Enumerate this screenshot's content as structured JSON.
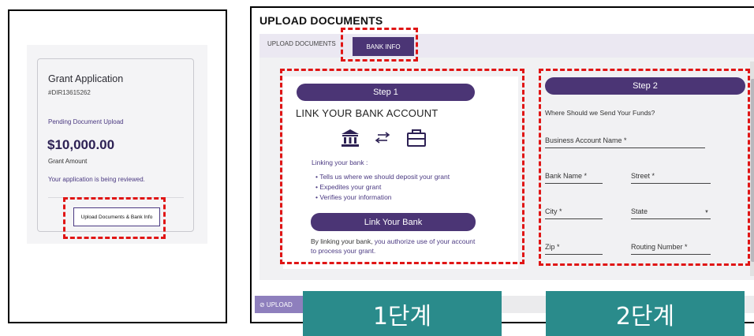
{
  "grant_card": {
    "title": "Grant Application",
    "id": "#DIR13615262",
    "status": "Pending Document Upload",
    "amount": "$10,000.00",
    "amount_label": "Grant Amount",
    "review_text": "Your application is being reviewed.",
    "button_label": "Upload Documents & Bank Info"
  },
  "upload_page": {
    "heading": "UPLOAD DOCUMENTS",
    "tabs": [
      {
        "label": "UPLOAD DOCUMENTS",
        "active": false
      },
      {
        "label": "BANK INFO",
        "active": true
      }
    ],
    "bottom_button": "⊘ UPLOAD"
  },
  "step1": {
    "pill": "Step 1",
    "title": "LINK YOUR BANK ACCOUNT",
    "icons": [
      "bank-icon",
      "transfer-arrows-icon",
      "briefcase-icon"
    ],
    "intro": "Linking your bank :",
    "bullets": [
      "Tells us where we should deposit your grant",
      "Expedites your grant",
      "Verifies your information"
    ],
    "button": "Link Your Bank",
    "auth_prefix": "By linking your bank,",
    "auth_highlight": " you authorize use of your account to process your grant."
  },
  "step2": {
    "pill": "Step 2",
    "question": "Where Should we Send Your Funds?",
    "fields": {
      "business_account_name": "Business Account Name *",
      "bank_name": "Bank Name *",
      "street": "Street *",
      "city": "City *",
      "state": "State",
      "zip": "Zip *",
      "routing_number": "Routing Number *"
    }
  },
  "overlay_labels": {
    "step1": "1단계",
    "step2": "2단계"
  },
  "colors": {
    "brand_purple": "#4b3575",
    "annotation_red": "#e01515",
    "label_teal": "#2a8b8b"
  }
}
